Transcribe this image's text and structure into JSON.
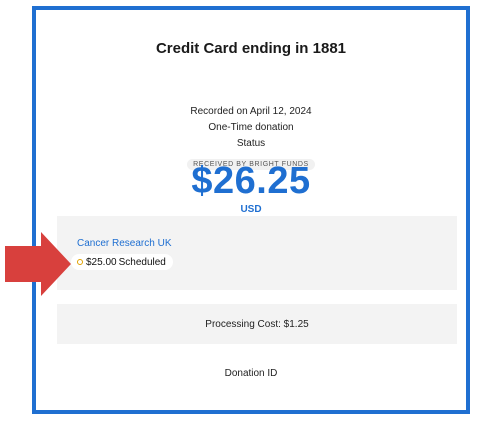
{
  "card": {
    "title": "Credit Card ending in 1881",
    "recorded": "Recorded on April 12, 2024",
    "donation_type": "One-Time donation",
    "status_label": "Status",
    "status_badge": "RECEIVED BY BRIGHT FUNDS",
    "amount": "$26.25",
    "currency": "USD"
  },
  "charity": {
    "name": "Cancer Research UK",
    "amount": "$25.00",
    "status": "Scheduled"
  },
  "processing_cost": "Processing Cost: $1.25",
  "donation_id_label": "Donation ID",
  "colors": {
    "accent": "#1f6fd1",
    "arrow": "#d8403d",
    "scheduled": "#e0a100",
    "panel": "#f3f3f3"
  }
}
